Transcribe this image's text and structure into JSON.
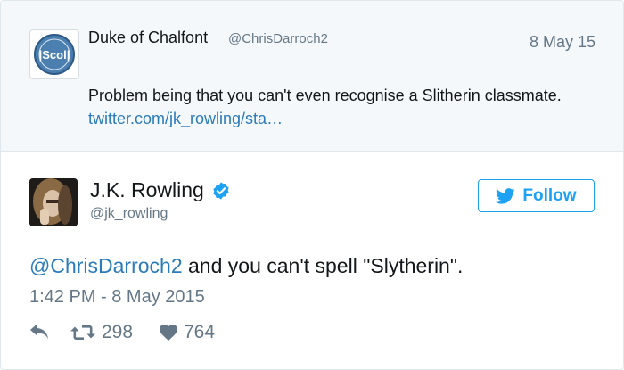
{
  "parent_tweet": {
    "author_name": "Duke of Chalfont",
    "author_handle": "@ChrisDarroch2",
    "date": "8 May 15",
    "text": "Problem being that you can't even recognise a Slitherin classmate.",
    "link_text": "twitter.com/jk_rowling/sta…",
    "avatar_logo_text": "Scol"
  },
  "tweet": {
    "author_name": "J.K. Rowling",
    "author_handle": "@jk_rowling",
    "verified": true,
    "follow_label": "Follow",
    "mention": "@ChrisDarroch2",
    "text": " and you can't spell \"Slytherin\".",
    "timestamp": "1:42 PM - 8 May 2015",
    "retweets": "298",
    "likes": "764"
  },
  "colors": {
    "accent": "#1da1f2",
    "link": "#2b7bb9",
    "muted": "#657786",
    "parent_background": "#f5f8fa"
  },
  "icons": [
    "reply-icon",
    "retweet-icon",
    "heart-icon",
    "twitter-bird-icon",
    "verified-badge-icon"
  ]
}
